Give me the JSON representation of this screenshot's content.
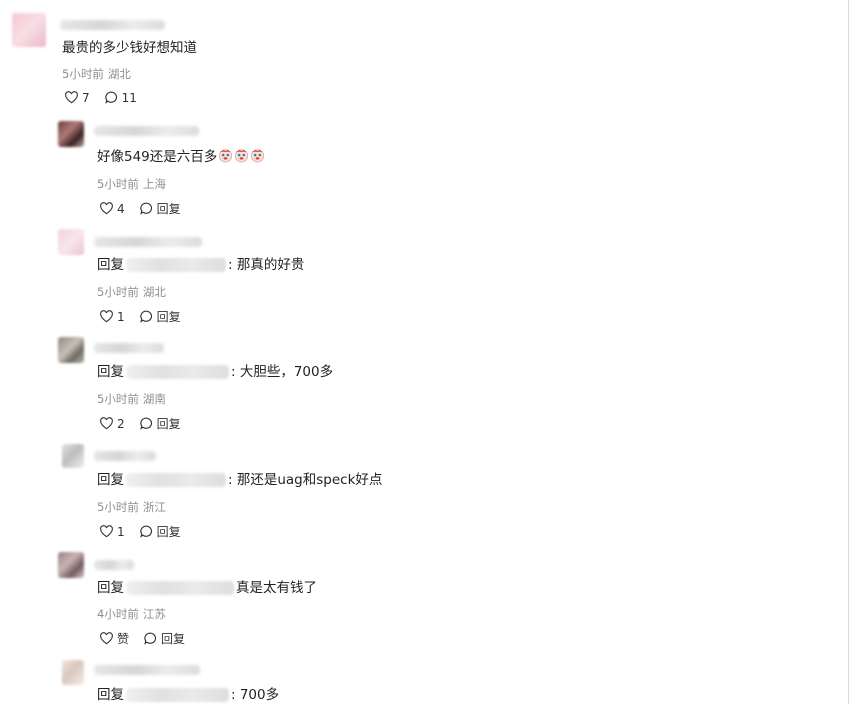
{
  "colors": {
    "text": "#222222",
    "meta": "#8f8f8f",
    "icon": "#333333",
    "blur": "#dedede"
  },
  "comments": [
    {
      "text": "最贵的多少钱好想知道",
      "time": "5小时前",
      "location": "湖北",
      "likes": "7",
      "replies": "11"
    },
    {
      "text": "好像549还是六百多",
      "emoji_count": 3,
      "time": "5小时前",
      "location": "上海",
      "likes": "4",
      "reply_label": "回复"
    },
    {
      "reply_prefix": "回复",
      "text": ": 那真的好贵",
      "time": "5小时前",
      "location": "湖北",
      "likes": "1",
      "reply_label": "回复"
    },
    {
      "reply_prefix": "回复",
      "text": ": 大胆些，700多",
      "time": "5小时前",
      "location": "湖南",
      "likes": "2",
      "reply_label": "回复"
    },
    {
      "reply_prefix": "回复",
      "text": ": 那还是uag和speck好点",
      "time": "5小时前",
      "location": "浙江",
      "likes": "1",
      "reply_label": "回复"
    },
    {
      "reply_prefix": "回复",
      "text": "真是太有钱了",
      "time": "4小时前",
      "location": "江苏",
      "likes": "赞",
      "reply_label": "回复"
    },
    {
      "reply_prefix": "回复",
      "text": ": 700多"
    }
  ]
}
